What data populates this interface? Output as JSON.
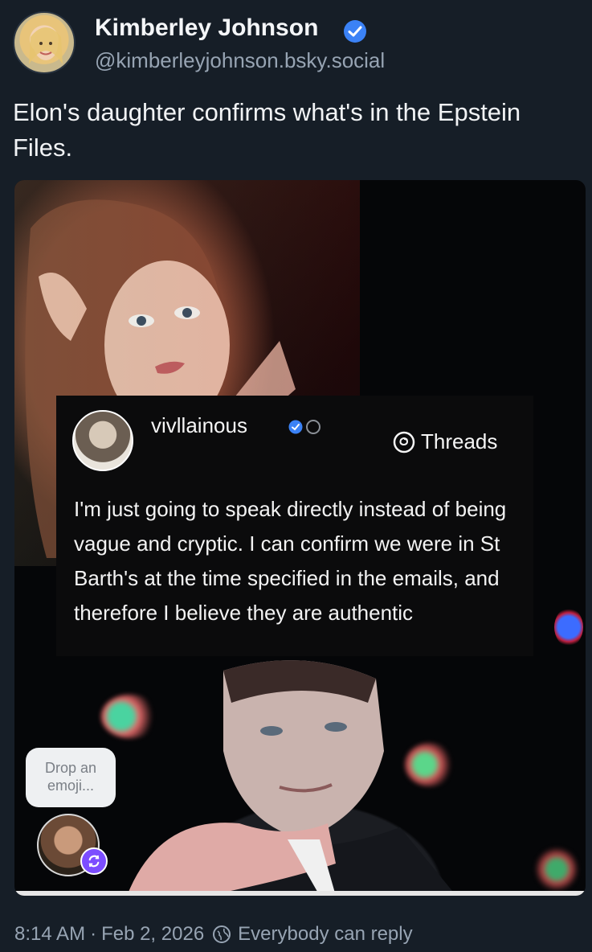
{
  "post": {
    "author": {
      "name": "Kimberley Johnson",
      "handle": "@kimberleyjohnson.bsky.social"
    },
    "text": "Elon's daughter confirms what's in the Epstein Files.",
    "timestamp": {
      "time": "8:14 AM",
      "separator": "·",
      "date": "Feb 2, 2026"
    },
    "reply_setting": "Everybody can reply"
  },
  "embedded_threads": {
    "username": "vivllainous",
    "platform_label": "Threads",
    "text": "I'm just going to speak directly instead of being vague and cryptic. I can confirm we were in St Barth's at the time specified in the emails, and therefore I believe they are authentic"
  },
  "overlay": {
    "drop_emoji_line1": "Drop an",
    "drop_emoji_line2": "emoji..."
  },
  "colors": {
    "background": "#161e27",
    "text_primary": "#f1f3f5",
    "text_secondary": "#97a4b3",
    "verified_blue": "#3b82f6",
    "refresh_badge": "#7c4dff"
  },
  "icons": {
    "verified": "verified-check-icon",
    "threads": "threads-logo-icon",
    "reply": "reply-globe-icon",
    "refresh": "refresh-icon"
  }
}
